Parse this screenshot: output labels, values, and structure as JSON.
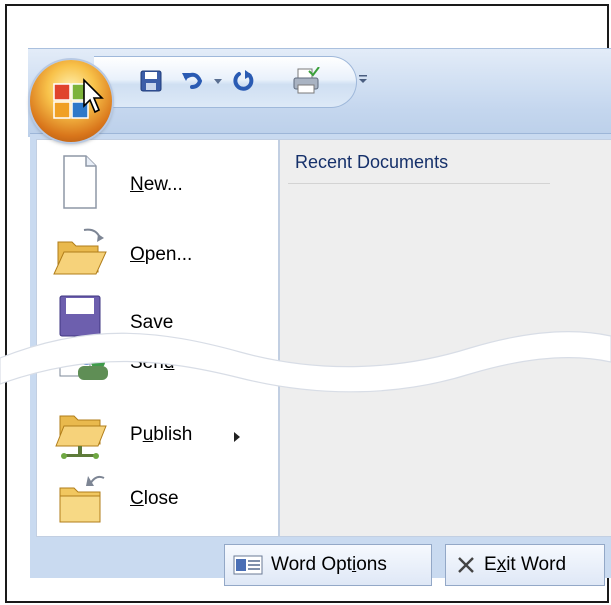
{
  "quick_access": {
    "icons": [
      "save-icon",
      "undo-icon",
      "dropdown-arrow-icon",
      "redo-icon",
      "print-preview-icon",
      "customize-toolbar-icon"
    ]
  },
  "office_button": {
    "icon": "office-logo-icon"
  },
  "menu": {
    "items": [
      {
        "pre": "",
        "ul": "N",
        "post": "ew...",
        "icon": "new-document-icon",
        "submenu": false
      },
      {
        "pre": "",
        "ul": "O",
        "post": "pen...",
        "icon": "open-folder-icon",
        "submenu": false
      },
      {
        "pre": "Save",
        "ul": "",
        "post": "",
        "icon": "save-icon",
        "submenu": false
      },
      {
        "pre": "Sen",
        "ul": "d",
        "post": "",
        "icon": "send-people-icon",
        "submenu": true
      },
      {
        "pre": "P",
        "ul": "u",
        "post": "blish",
        "icon": "publish-folder-icon",
        "submenu": true
      },
      {
        "pre": "",
        "ul": "C",
        "post": "lose",
        "icon": "close-folder-icon",
        "submenu": false
      }
    ]
  },
  "recent": {
    "title": "Recent Documents"
  },
  "footer": {
    "word_options": {
      "pre": "Word Opt",
      "ul": "i",
      "post": "ons"
    },
    "exit_word": {
      "pre": "E",
      "ul": "x",
      "post": "it Word"
    }
  },
  "colors": {
    "ribbon_blue": "#c4d6ee",
    "recent_title": "#15306a",
    "office_orange": "#f8c24a"
  }
}
